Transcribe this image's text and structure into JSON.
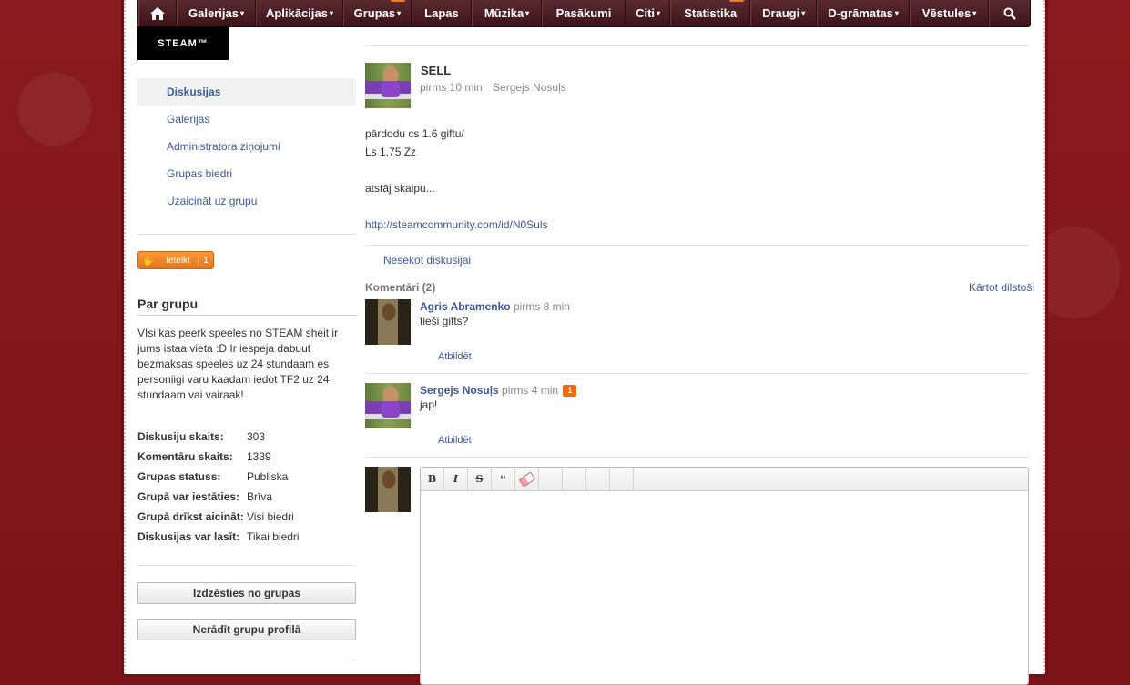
{
  "nav": {
    "items": [
      {
        "label": "Galerijas",
        "dropdown": true
      },
      {
        "label": "Aplikācijas",
        "dropdown": true
      },
      {
        "label": "Grupas",
        "dropdown": true
      },
      {
        "label": "Lapas",
        "dropdown": false
      },
      {
        "label": "Mūzika",
        "dropdown": true
      },
      {
        "label": "Pasākumi",
        "dropdown": false
      },
      {
        "label": "Citi",
        "dropdown": true
      },
      {
        "label": "Statistika",
        "dropdown": false
      },
      {
        "label": "Draugi",
        "dropdown": true
      },
      {
        "label": "D-grāmatas",
        "dropdown": true
      },
      {
        "label": "Vēstules",
        "dropdown": true
      }
    ],
    "arrow": "▾"
  },
  "group": {
    "logo_text": "STEAM™"
  },
  "sidebar": {
    "items": [
      {
        "label": "Diskusijas"
      },
      {
        "label": "Galerijas"
      },
      {
        "label": "Administratora ziņojumi"
      },
      {
        "label": "Grupas biedri"
      },
      {
        "label": "Uzaicināt uz grupu"
      }
    ],
    "like_label": "Ieteikt",
    "like_count": "1",
    "about_title": "Par grupu",
    "about_text": "VIsi kas peerk speeles no STEAM sheit ir jums istaa vieta :D Ir iespeja dabuut bezmaksas speeles uz 24 stundaam es personiigi varu kaadam iedot TF2 uz 24 stundaam vai vairaak!",
    "stats": [
      {
        "key": "Diskusiju skaits:",
        "value": "303"
      },
      {
        "key": "Komentāru skaits:",
        "value": "1339"
      },
      {
        "key": "Grupas statuss:",
        "value": "Publiska"
      },
      {
        "key": "Grupā var iestāties:",
        "value": "Brīva"
      },
      {
        "key": "Grupā drīkst aicināt:",
        "value": "Visi biedri"
      },
      {
        "key": "Diskusijas var lasīt:",
        "value": "Tikai biedri"
      }
    ],
    "leave_button": "Izdzēsties no grupas",
    "hide_button": "Nerādīt grupu profilā"
  },
  "post": {
    "title": "SELL",
    "time": "pirms 10 min",
    "author": "Sergejs Nosuļs",
    "lines": [
      "pārdodu cs 1.6 giftu/",
      "Ls 1,75 Zz",
      "",
      "atstāj skaipu...",
      ""
    ],
    "link": "http://steamcommunity.com/id/N0Suls",
    "unfollow": "Nesekot diskusijai"
  },
  "comments": {
    "title": "Komentāri (2)",
    "sort": "Kārtot dilstoši",
    "reply_label": "Atbildēt",
    "items": [
      {
        "author": "Agris Abramenko",
        "time": "pirms 8 min",
        "text": "tieši gifts?",
        "badge": ""
      },
      {
        "author": "Sergejs Nosuļs",
        "time": "pirms 4 min",
        "text": "jap!",
        "badge": "1"
      }
    ]
  },
  "editor": {
    "bold": "B",
    "italic": "I",
    "strike": "S",
    "quote": "“"
  }
}
